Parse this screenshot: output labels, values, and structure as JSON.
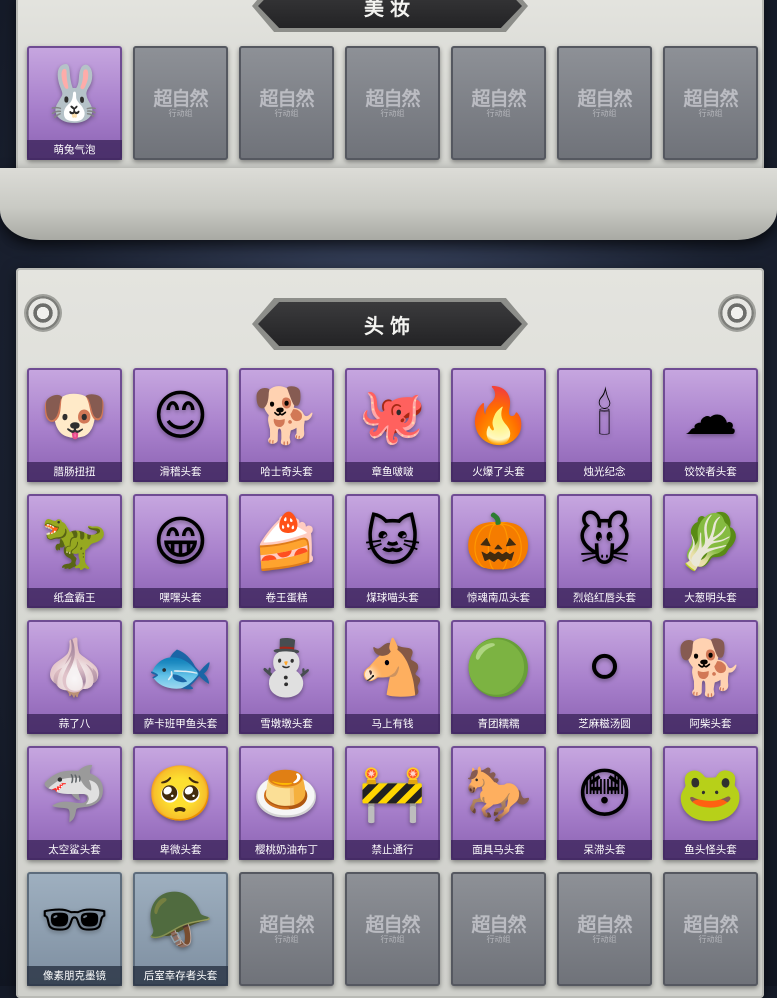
{
  "sections": {
    "makeup": {
      "title": "美妆"
    },
    "headwear": {
      "title": "头饰"
    }
  },
  "watermark": {
    "main": "超自然",
    "sub": "行动组"
  },
  "makeup_items": [
    {
      "label": "萌兔气泡",
      "icon": "bunny-bubble-icon",
      "glyph": "🐰",
      "rarity": "purple"
    },
    {
      "label": "",
      "empty": true
    },
    {
      "label": "",
      "empty": true
    },
    {
      "label": "",
      "empty": true
    },
    {
      "label": "",
      "empty": true
    },
    {
      "label": "",
      "empty": true
    },
    {
      "label": "",
      "empty": true
    }
  ],
  "headwear_items": [
    {
      "label": "腊肠扭扭",
      "icon": "dachshund-icon",
      "glyph": "🐶",
      "rarity": "purple"
    },
    {
      "label": "滑稽头套",
      "icon": "funny-face-icon",
      "glyph": "😊",
      "rarity": "purple"
    },
    {
      "label": "哈士奇头套",
      "icon": "husky-sunglasses-icon",
      "glyph": "🐕",
      "rarity": "purple"
    },
    {
      "label": "章鱼啵啵",
      "icon": "octopus-icon",
      "glyph": "🐙",
      "rarity": "purple"
    },
    {
      "label": "火爆了头套",
      "icon": "fire-spirit-icon",
      "glyph": "🔥",
      "rarity": "purple"
    },
    {
      "label": "烛光纪念",
      "icon": "candle-icon",
      "glyph": "🕯",
      "rarity": "purple"
    },
    {
      "label": "饺饺者头套",
      "icon": "dumpling-icon",
      "glyph": "☁",
      "rarity": "purple"
    },
    {
      "label": "纸盒霸王",
      "icon": "cardboard-shark-icon",
      "glyph": "🦖",
      "rarity": "purple"
    },
    {
      "label": "嘿嘿头套",
      "icon": "grinning-face-icon",
      "glyph": "😁",
      "rarity": "purple"
    },
    {
      "label": "卷王蛋糕",
      "icon": "roll-cake-icon",
      "glyph": "🍰",
      "rarity": "purple"
    },
    {
      "label": "煤球喵头套",
      "icon": "black-cat-icon",
      "glyph": "🐱",
      "rarity": "purple"
    },
    {
      "label": "惊魂南瓜头套",
      "icon": "pumpkin-icon",
      "glyph": "🎃",
      "rarity": "purple"
    },
    {
      "label": "烈焰红唇头套",
      "icon": "yellow-mouse-icon",
      "glyph": "🐭",
      "rarity": "purple"
    },
    {
      "label": "大葱明头套",
      "icon": "green-onion-icon",
      "glyph": "🥬",
      "rarity": "purple"
    },
    {
      "label": "蒜了八",
      "icon": "garlic-icon",
      "glyph": "🧄",
      "rarity": "purple"
    },
    {
      "label": "萨卡班甲鱼头套",
      "icon": "fish-head-icon",
      "glyph": "🐟",
      "rarity": "purple"
    },
    {
      "label": "雪墩墩头套",
      "icon": "snowman-icon",
      "glyph": "⛄",
      "rarity": "purple"
    },
    {
      "label": "马上有钱",
      "icon": "red-horse-icon",
      "glyph": "🐴",
      "rarity": "purple"
    },
    {
      "label": "青团糯糯",
      "icon": "green-rice-ball-icon",
      "glyph": "🟢",
      "rarity": "purple"
    },
    {
      "label": "芝麻糍汤圆",
      "icon": "tangyuan-icon",
      "glyph": "⚪",
      "rarity": "purple"
    },
    {
      "label": "阿柴头套",
      "icon": "shiba-icon",
      "glyph": "🐕",
      "rarity": "purple"
    },
    {
      "label": "太空鲨头套",
      "icon": "space-shark-icon",
      "glyph": "🦈",
      "rarity": "purple"
    },
    {
      "label": "卑微头套",
      "icon": "sad-face-icon",
      "glyph": "🥺",
      "rarity": "purple"
    },
    {
      "label": "樱桃奶油布丁",
      "icon": "pudding-icon",
      "glyph": "🍮",
      "rarity": "purple"
    },
    {
      "label": "禁止通行",
      "icon": "traffic-cone-icon",
      "glyph": "🚧",
      "rarity": "purple"
    },
    {
      "label": "面具马头套",
      "icon": "horse-mask-icon",
      "glyph": "🐎",
      "rarity": "purple"
    },
    {
      "label": "呆滞头套",
      "icon": "dazed-face-icon",
      "glyph": "😳",
      "rarity": "purple"
    },
    {
      "label": "鱼头怪头套",
      "icon": "fish-monster-icon",
      "glyph": "🐸",
      "rarity": "purple"
    },
    {
      "label": "像素朋克墨镜",
      "icon": "pixel-sunglasses-icon",
      "glyph": "🕶",
      "rarity": "gray-blue"
    },
    {
      "label": "后室幸存者头套",
      "icon": "gas-mask-helmet-icon",
      "glyph": "🪖",
      "rarity": "gray-blue"
    },
    {
      "label": "",
      "empty": true
    },
    {
      "label": "",
      "empty": true
    },
    {
      "label": "",
      "empty": true
    },
    {
      "label": "",
      "empty": true
    },
    {
      "label": "",
      "empty": true
    }
  ]
}
